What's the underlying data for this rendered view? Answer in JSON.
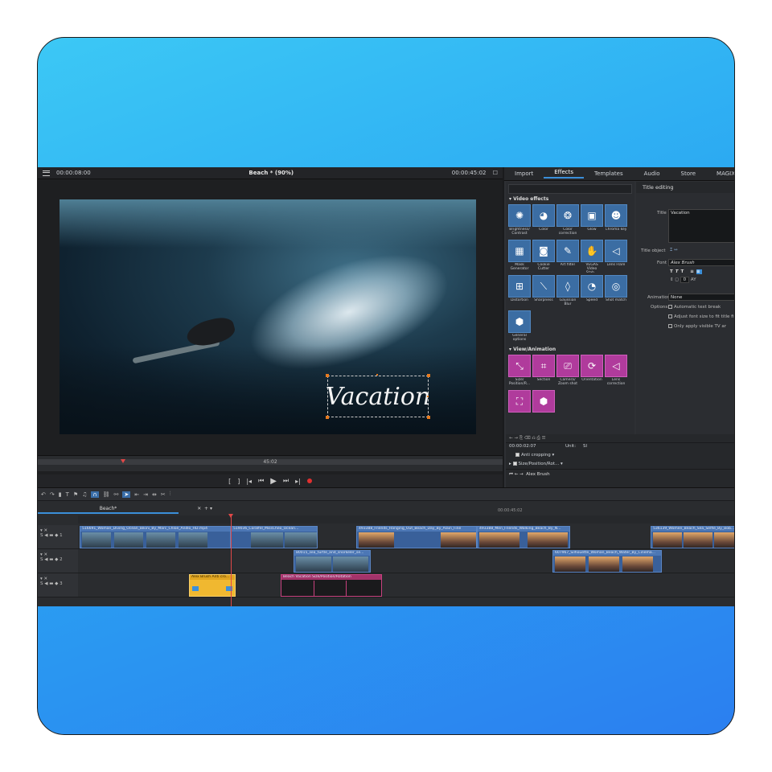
{
  "preview": {
    "time_left": "00:00:08:00",
    "title": "Beach *  (90%)",
    "time_right": "00:00:45:02",
    "overlay_title": "Vacation",
    "scrub_label": "45:02"
  },
  "right_panel": {
    "tabs": [
      {
        "label": "Import"
      },
      {
        "label": "Effects"
      },
      {
        "label": "Templates"
      },
      {
        "label": "Audio"
      },
      {
        "label": "Store"
      },
      {
        "label": "MAGIX Hub"
      }
    ],
    "video_effects_header": "Video effects",
    "video_effects": [
      {
        "label": "Brightness/ Contrast",
        "icon": "sun-icon"
      },
      {
        "label": "Color",
        "icon": "palette-icon"
      },
      {
        "label": "Color correction",
        "icon": "color-wheel-icon"
      },
      {
        "label": "Glow",
        "icon": "glow-icon"
      },
      {
        "label": "Chroma key",
        "icon": "chroma-key-icon"
      },
      {
        "label": "Mask Generator",
        "icon": "mask-icon"
      },
      {
        "label": "Cookie Cutter",
        "icon": "cookie-cutter-icon"
      },
      {
        "label": "Art filter",
        "icon": "brush-icon"
      },
      {
        "label": "VEGAS Video Stab...",
        "icon": "hand-icon"
      },
      {
        "label": "Lens Flare",
        "icon": "lens-flare-icon"
      },
      {
        "label": "Distortion",
        "icon": "grid-icon"
      },
      {
        "label": "Sharpness",
        "icon": "sharpness-icon"
      },
      {
        "label": "Gaussian Blur",
        "icon": "drop-icon"
      },
      {
        "label": "Speed",
        "icon": "speed-icon"
      },
      {
        "label": "Shot match",
        "icon": "shot-match-icon"
      },
      {
        "label": "General options",
        "icon": "hexagon-icon"
      }
    ],
    "view_animation_header": "View/Animation",
    "view_animation": [
      {
        "label": "Size/ Position/R...",
        "icon": "resize-icon"
      },
      {
        "label": "Section",
        "icon": "crop-icon"
      },
      {
        "label": "Camera/ Zoom shot",
        "icon": "camera-icon"
      },
      {
        "label": "Orientation",
        "icon": "rotate-icon"
      },
      {
        "label": "Lens correction",
        "icon": "lens-icon"
      },
      {
        "label": "",
        "icon": "transform-icon"
      },
      {
        "label": "",
        "icon": "hexagon-icon"
      }
    ],
    "title_editing": {
      "header": "Title editing",
      "title_label": "Title",
      "title_value": "Vacation",
      "title_object_label": "Title object",
      "font_label": "Font",
      "font_value": "Alex Brush",
      "font_size": "0",
      "animation_label": "Animation",
      "animation_value": "None",
      "options_label": "Options",
      "options": [
        "Automatic text break",
        "Adjust font size to fit title fi",
        "Only apply visible TV ar"
      ]
    },
    "keyframes": {
      "time": "00:00:02:07",
      "unit_label": "Unit:",
      "unit_value": "Sl",
      "rows": [
        "Anti cropping",
        "Size/Position/Rot..."
      ]
    },
    "bottom_font": "Alex Brush"
  },
  "timeline": {
    "tab": "Beach*",
    "ruler_end": "00:00:45:02",
    "tracks": [
      {
        "num": "1",
        "clips": [
          {
            "label": "516691_Woman_Diving_Ocean_Bikini_By_Marc_Chloe_Andlo_HD.mp4"
          },
          {
            "label": "519036_Coralfel_MissCheo_Ocean..."
          },
          {
            "label": "493388_Friends_Hanging_Out_Beach_Day_By_Alain_Fine"
          },
          {
            "label": "493388_Men_Friends_Walking_Beach_By_N..."
          },
          {
            "label": "536139_Women_Beach_Sea_Selfie_By_Bob..."
          }
        ]
      },
      {
        "num": "2",
        "clips": [
          {
            "label": "80015_sea_turtle_and_snorkeler_se..."
          },
          {
            "label": "607967_Silhouette_Woman_Beach_Water_By_Cinema..."
          }
        ]
      },
      {
        "num": "3",
        "clips": [
          {
            "label": "Alex Brush   Anti cro..."
          },
          {
            "label": "Beach Vacation   Size/Position/Rotation"
          }
        ]
      }
    ]
  },
  "colors": {
    "frame_gradient_top": "#3cc8f5",
    "frame_gradient_bottom": "#2b7ff0",
    "accent": "#3b8fd9",
    "effect_tile": "#3b6da3",
    "animation_tile": "#b03b9c",
    "title_clip": "#f0b830",
    "playhead": "#e04848"
  }
}
